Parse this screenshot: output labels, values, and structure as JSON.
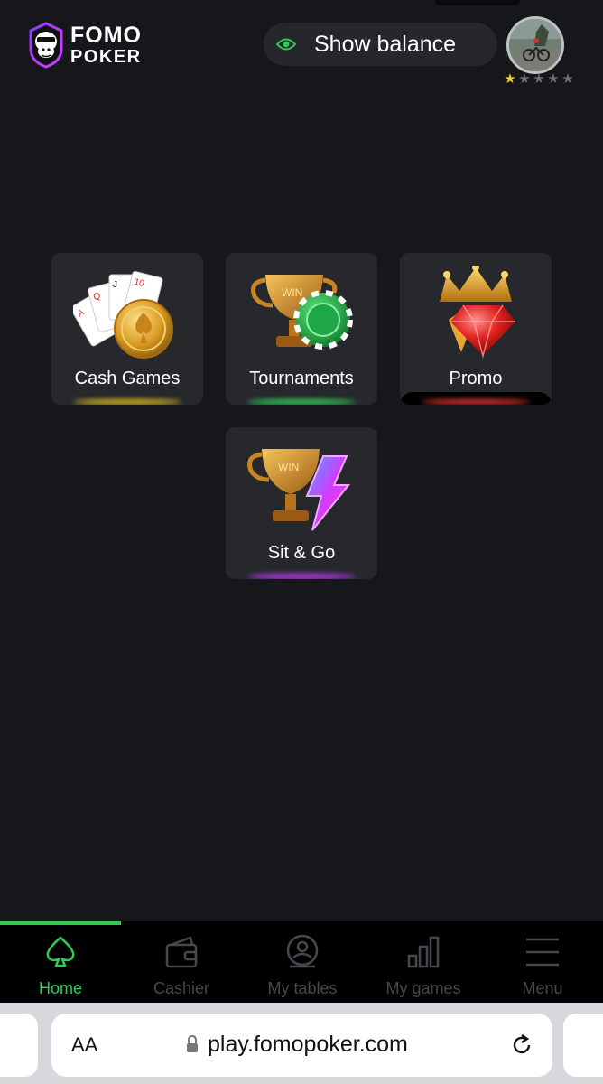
{
  "header": {
    "logo_line1": "FOMO",
    "logo_line2": "POKER",
    "balance_label": "Show balance",
    "rating": {
      "filled": 1,
      "total": 5
    }
  },
  "games": [
    {
      "label": "Cash Games",
      "icon": "cash-games-icon",
      "glow": "#d6b41f"
    },
    {
      "label": "Tournaments",
      "icon": "tournaments-icon",
      "glow": "#2ecc55"
    },
    {
      "label": "Promo",
      "icon": "promo-icon",
      "glow": "#e0322f"
    },
    {
      "label": "Sit & Go",
      "icon": "sit-and-go-icon",
      "glow": "#b43be6"
    }
  ],
  "nav": {
    "items": [
      {
        "label": "Home",
        "icon": "spade-icon",
        "active": true
      },
      {
        "label": "Cashier",
        "icon": "wallet-icon",
        "active": false
      },
      {
        "label": "My tables",
        "icon": "my-tables-icon",
        "active": false
      },
      {
        "label": "My games",
        "icon": "bar-chart-icon",
        "active": false
      },
      {
        "label": "Menu",
        "icon": "menu-icon",
        "active": false
      }
    ]
  },
  "browser": {
    "text_size_label": "AA",
    "url": "play.fomopoker.com"
  },
  "colors": {
    "background": "#16171b",
    "tile": "#26282c",
    "accent_green": "#2ecc55",
    "nav_inactive": "#46484d"
  }
}
